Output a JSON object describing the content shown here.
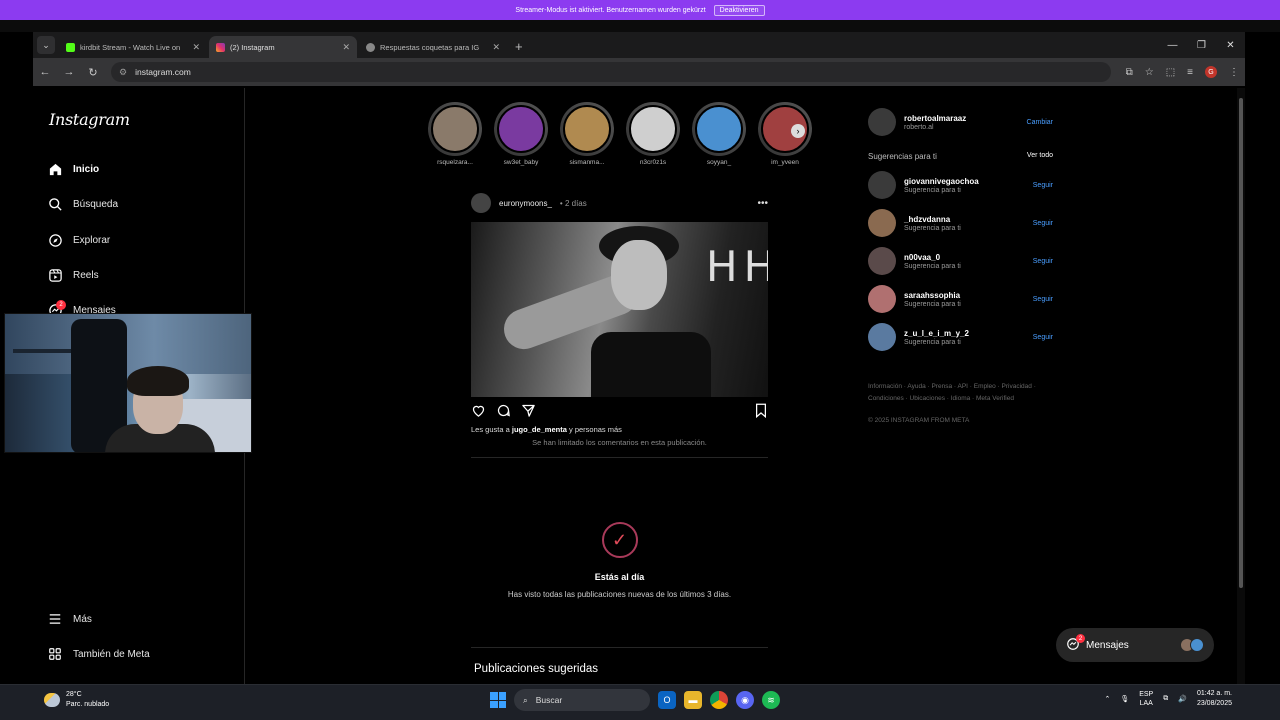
{
  "banner": {
    "text": "Streamer-Modus ist aktiviert. Benutzernamen wurden gekürzt",
    "button": "Deaktivieren"
  },
  "tabs": [
    {
      "title": "kirdbit Stream - Watch Live on",
      "color": "#53fc18"
    },
    {
      "title": "(2) Instagram",
      "color": "#e1306c"
    },
    {
      "title": "Respuestas coquetas para IG",
      "color": "#888888"
    }
  ],
  "url": "instagram.com",
  "sidebar": {
    "logo": "Instagram",
    "items": [
      {
        "label": "Inicio"
      },
      {
        "label": "Búsqueda"
      },
      {
        "label": "Explorar"
      },
      {
        "label": "Reels"
      },
      {
        "label": "Mensajes",
        "badge": "2"
      },
      {
        "label": "Más"
      },
      {
        "label": "También de Meta"
      }
    ]
  },
  "stories": [
    {
      "name": "rsquelzara...",
      "color": "#8a7a6a"
    },
    {
      "name": "sw3et_baby",
      "color": "#7a3aa0"
    },
    {
      "name": "sismanma...",
      "color": "#b08a50"
    },
    {
      "name": "n3cr0z1s",
      "color": "#cfcfcf"
    },
    {
      "name": "soyyan_",
      "color": "#4a90d0"
    },
    {
      "name": "im_yveen",
      "color": "#a04040"
    }
  ],
  "post": {
    "user": "euronymoons_",
    "time": "• 2 días",
    "image_text": "HHY",
    "likes_prefix": "Les gusta a",
    "likes_user": "jugo_de_menta",
    "likes_suffix": "y personas más",
    "limited": "Se han limitado los comentarios en esta publicación."
  },
  "caught_up": {
    "title": "Estás al día",
    "subtitle": "Has visto todas las publicaciones nuevas de los últimos 3 días."
  },
  "suggested_posts": "Publicaciones sugeridas",
  "profile": {
    "username": "robertoalmaraaz",
    "name": "roberto.al",
    "switch": "Cambiar"
  },
  "suggestions": {
    "title": "Sugerencias para ti",
    "see_all": "Ver todo",
    "items": [
      {
        "username": "giovannivegaochoa",
        "sub": "Sugerencia para ti",
        "action": "Seguir",
        "color": "#3a3a3a"
      },
      {
        "username": "_hdzvdanna",
        "sub": "Sugerencia para ti",
        "action": "Seguir",
        "color": "#8a6a50"
      },
      {
        "username": "n00vaa_0",
        "sub": "Sugerencia para ti",
        "action": "Seguir",
        "color": "#5a4a4a"
      },
      {
        "username": "saraahssophia",
        "sub": "Sugerencia para ti",
        "action": "Seguir",
        "color": "#b07070"
      },
      {
        "username": "z_u_l_e_i_m_y_2",
        "sub": "Sugerencia para ti",
        "action": "Seguir",
        "color": "#5a7aa0"
      }
    ]
  },
  "footer": {
    "links": "Información · Ayuda · Prensa · API · Empleo · Privacidad · Condiciones · Ubicaciones · Idioma · Meta Verified",
    "copyright": "© 2025 INSTAGRAM FROM META"
  },
  "messages_pill": {
    "label": "Mensajes",
    "badge": "2"
  },
  "taskbar": {
    "temp": "28°C",
    "weather": "Parc. nublado",
    "search": "Buscar",
    "lang1": "ESP",
    "lang2": "LAA",
    "time": "01:42 a. m.",
    "date": "23/08/2025"
  }
}
